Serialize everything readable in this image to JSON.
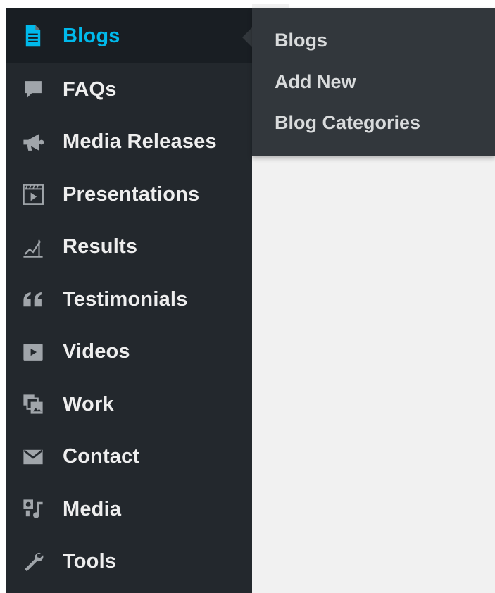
{
  "sidebar": {
    "items": [
      {
        "label": "Blogs",
        "icon": "document-icon",
        "current": true
      },
      {
        "label": "FAQs",
        "icon": "speech-bubble-icon"
      },
      {
        "label": "Media Releases",
        "icon": "megaphone-icon"
      },
      {
        "label": "Presentations",
        "icon": "video-frame-icon"
      },
      {
        "label": "Results",
        "icon": "chart-line-icon"
      },
      {
        "label": "Testimonials",
        "icon": "quote-icon"
      },
      {
        "label": "Videos",
        "icon": "play-button-icon"
      },
      {
        "label": "Work",
        "icon": "portfolio-icon"
      },
      {
        "label": "Contact",
        "icon": "envelope-icon"
      },
      {
        "label": "Media",
        "icon": "media-icon"
      },
      {
        "label": "Tools",
        "icon": "wrench-icon"
      }
    ]
  },
  "flyout": {
    "items": [
      {
        "label": "Blogs"
      },
      {
        "label": "Add New"
      },
      {
        "label": "Blog Categories"
      }
    ]
  },
  "colors": {
    "sidebar_bg": "#23282d",
    "current_bg": "#191e23",
    "accent": "#00b9eb",
    "flyout_bg": "#32373c",
    "text": "#eeeeee",
    "icon": "#a0a5aa"
  }
}
